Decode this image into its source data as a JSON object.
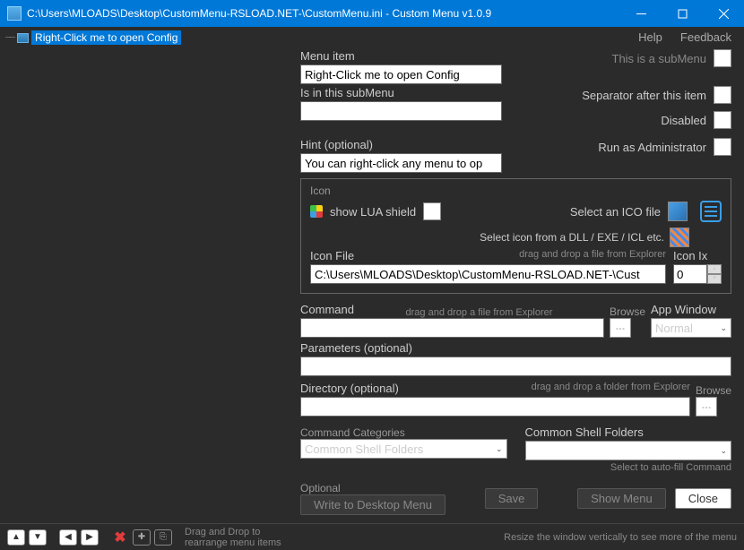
{
  "title": "C:\\Users\\MLOADS\\Desktop\\CustomMenu-RSLOAD.NET-\\CustomMenu.ini - Custom Menu v1.0.9",
  "tree": {
    "item0": "Right-Click me to open Config"
  },
  "links": {
    "help": "Help",
    "feedback": "Feedback"
  },
  "labels": {
    "menuItem": "Menu item",
    "isInSub": "Is in this subMenu",
    "hint": "Hint (optional)",
    "thisSub": "This is a subMenu",
    "sepAfter": "Separator after this item",
    "disabled": "Disabled",
    "runAdmin": "Run as Administrator",
    "icon": "Icon",
    "showLua": "show LUA shield",
    "selIco": "Select an ICO file",
    "selDll": "Select icon from a DLL / EXE / ICL etc.",
    "dragFile": "drag and drop a file from Explorer",
    "dragFolder": "drag and drop a folder from Explorer",
    "iconFile": "Icon File",
    "iconIx": "Icon Ix",
    "command": "Command",
    "browse": "Browse",
    "appWin": "App Window",
    "params": "Parameters (optional)",
    "dir": "Directory (optional)",
    "cmdCat": "Command Categories",
    "csf": "Common Shell Folders",
    "selAuto": "Select to auto-fill Command",
    "optional": "Optional",
    "writeDesk": "Write to Desktop Menu",
    "save": "Save",
    "showMenu": "Show Menu",
    "close": "Close",
    "dragHint": "Drag and Drop to\nrearrange menu items",
    "resizeHint": "Resize the window vertically to see more of the menu"
  },
  "values": {
    "menuItem": "Right-Click me to open Config",
    "isInSub": "",
    "hint": "You can right-click any menu to op",
    "iconFile": "C:\\Users\\MLOADS\\Desktop\\CustomMenu-RSLOAD.NET-\\Cust",
    "iconIx": "0",
    "command": "",
    "appWin": "Normal",
    "params": "",
    "dir": "",
    "cmdCat": "Common Shell Folders",
    "csf": ""
  }
}
